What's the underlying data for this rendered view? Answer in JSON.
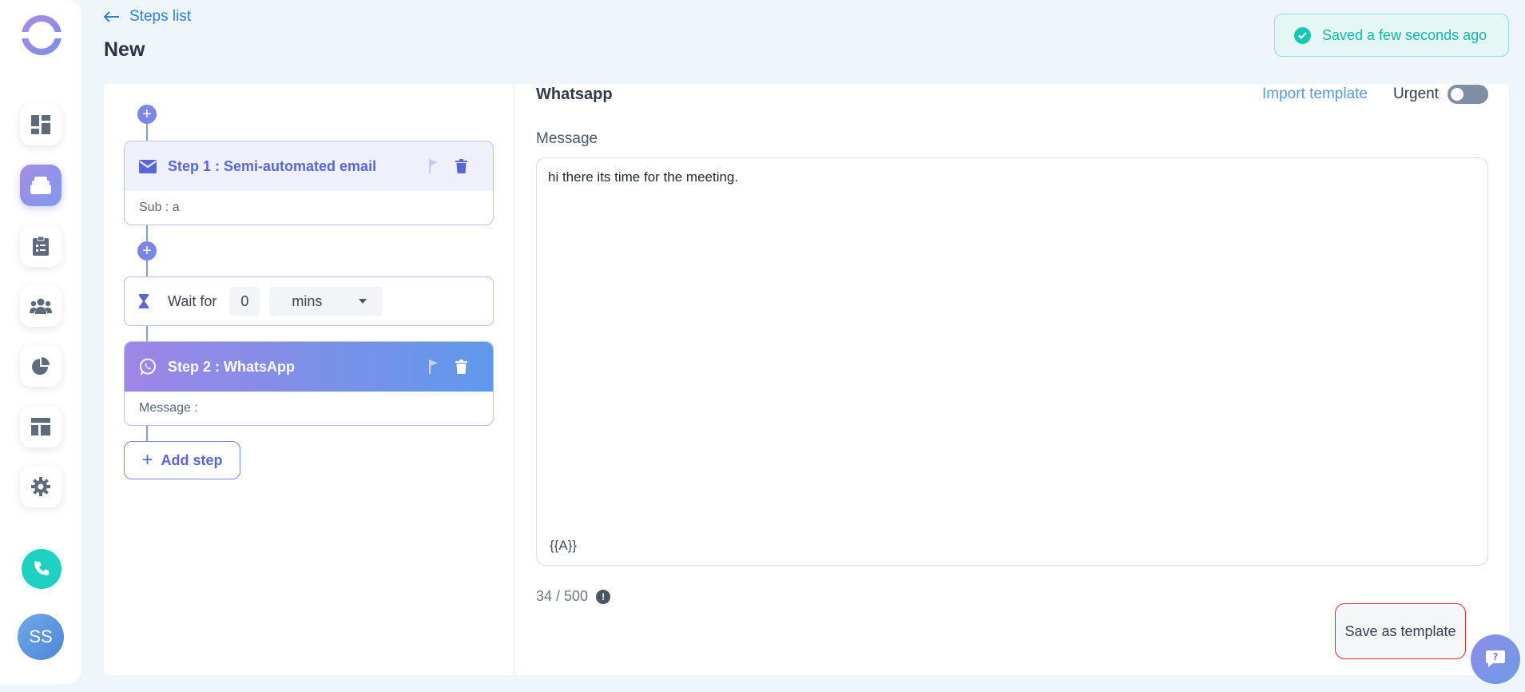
{
  "header": {
    "back_label": "Steps list",
    "title": "New",
    "save_status": "Saved a few seconds ago"
  },
  "sidebar": {
    "items": [
      {
        "name": "dashboard",
        "icon": "dashboard-icon"
      },
      {
        "name": "sequences",
        "icon": "inbox-tray-icon",
        "active": true
      },
      {
        "name": "tasks",
        "icon": "clipboard-icon"
      },
      {
        "name": "contacts",
        "icon": "people-icon"
      },
      {
        "name": "reports",
        "icon": "pie-chart-icon"
      },
      {
        "name": "templates",
        "icon": "layout-icon"
      },
      {
        "name": "settings",
        "icon": "gear-icon"
      }
    ],
    "phone_icon": "phone-icon",
    "avatar_initials": "SS"
  },
  "steps": [
    {
      "title": "Step 1 : Semi-automated email",
      "body": "Sub : a",
      "icon": "envelope-icon"
    },
    {
      "title": "Step 2 : WhatsApp",
      "body": "Message :",
      "icon": "whatsapp-icon"
    }
  ],
  "wait": {
    "label": "Wait for",
    "value": "0",
    "unit": "mins"
  },
  "add_step_label": "Add step",
  "editor": {
    "channel": "Whatsapp",
    "import_label": "Import template",
    "urgent_label": "Urgent",
    "urgent_on": false,
    "message_label": "Message",
    "message_text": "hi there its time for the meeting.",
    "variable": "{{A}}",
    "char_count": "34 / 500",
    "save_template_label": "Save as template"
  },
  "colors": {
    "accent": "#7b86e6",
    "link": "#2f7fd6",
    "success": "#19c6b3",
    "highlight_border": "#e0263a"
  }
}
